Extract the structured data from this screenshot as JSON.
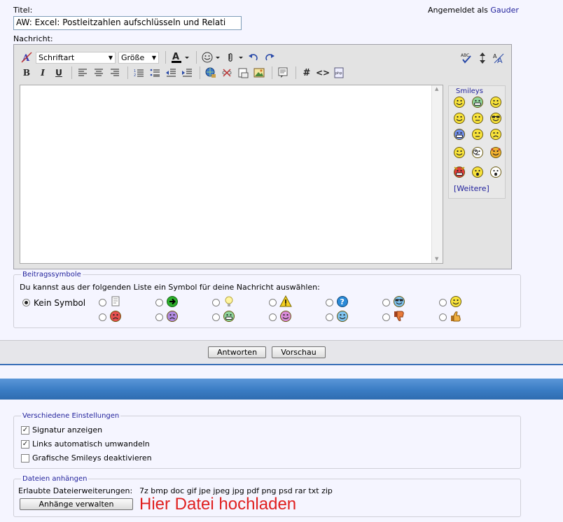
{
  "form": {
    "title_label": "Titel:",
    "title_value": "AW: Excel: Postleitzahlen aufschlüsseln und Relati",
    "logged_in_prefix": "Angemeldet als",
    "username": "Gauder",
    "message_label": "Nachricht:"
  },
  "toolbar": {
    "font_select": "Schriftart",
    "size_select": "Größe"
  },
  "smileys": {
    "title": "Smileys",
    "more": "[Weitere]"
  },
  "post_icons": {
    "legend": "Beitragssymbole",
    "description": "Du kannst aus der folgenden Liste ein Symbol für deine Nachricht auswählen:",
    "none_label": "Kein Symbol"
  },
  "buttons": {
    "reply": "Antworten",
    "preview": "Vorschau",
    "manage_attachments": "Anhänge verwalten"
  },
  "options": {
    "legend": "Verschiedene Einstellungen",
    "items": [
      {
        "label": "Signatur anzeigen",
        "checked": true
      },
      {
        "label": "Links automatisch umwandeln",
        "checked": true
      },
      {
        "label": "Grafische Smileys deaktivieren",
        "checked": false
      }
    ]
  },
  "attachments": {
    "legend": "Dateien anhängen",
    "allowed_prefix": "Erlaubte Dateierweiterungen:",
    "allowed_exts": "7z bmp doc gif jpe jpeg jpg pdf png psd rar txt zip",
    "annotation": "Hier Datei hochladen"
  },
  "colors": {
    "accent_link": "#22229c",
    "band": "#3a7cc4",
    "annotation": "#e02020"
  }
}
